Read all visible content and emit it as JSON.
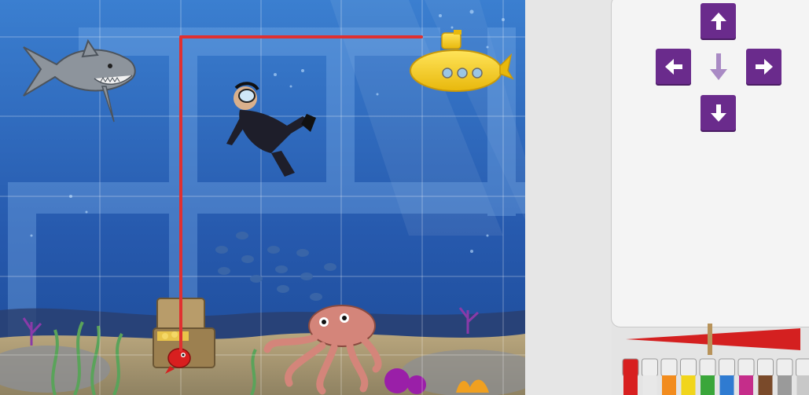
{
  "game": {
    "board": {
      "grid": {
        "columns": 6.5,
        "rows": 5
      },
      "characters": [
        "shark",
        "diver",
        "submarine",
        "treasure-chest",
        "red-fish",
        "octopus",
        "fish-school"
      ],
      "path_color": "#e03030",
      "water_colors": {
        "top": "#3a78c9",
        "bottom": "#1e4fa0",
        "sand": "#c9b48a"
      }
    },
    "controls": {
      "buttons": [
        {
          "name": "up-arrow-button",
          "icon": "arrow-up-icon"
        },
        {
          "name": "left-arrow-button",
          "icon": "arrow-left-icon"
        },
        {
          "name": "right-arrow-button",
          "icon": "arrow-right-icon"
        },
        {
          "name": "down-arrow-button",
          "icon": "arrow-down-icon"
        }
      ],
      "current_direction": "down",
      "button_color": "#6a2b8c"
    },
    "pens": {
      "colors": [
        "#d81f1f",
        "#e8e8e8",
        "#f28c1e",
        "#f1d51c",
        "#3aa63a",
        "#2f7bd1",
        "#c52d8a",
        "#7a4a2a",
        "#9a9a9a",
        "#c8c8c8",
        "#e0e0e0"
      ],
      "selected_color": "#d81f1f"
    }
  }
}
